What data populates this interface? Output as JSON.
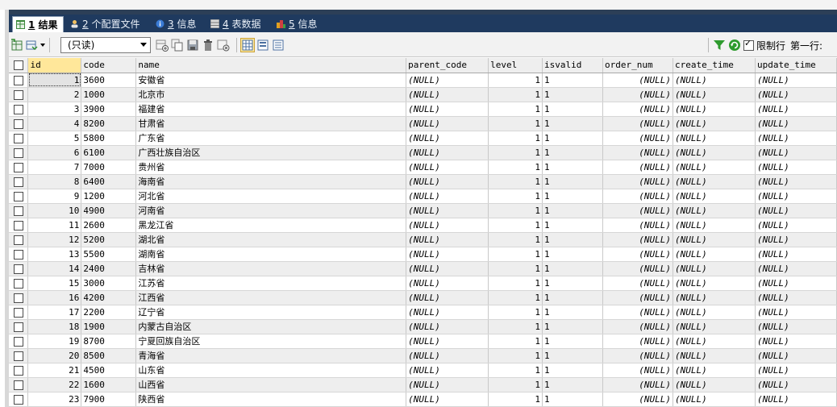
{
  "tabs": [
    {
      "num": "1",
      "label": "结果",
      "active": true,
      "icon": "grid-result-icon"
    },
    {
      "num": "2",
      "label": "个配置文件",
      "active": false,
      "icon": "profile-icon"
    },
    {
      "num": "3",
      "label": "信息",
      "active": false,
      "icon": "info-icon"
    },
    {
      "num": "4",
      "label": "表数据",
      "active": false,
      "icon": "table-data-icon"
    },
    {
      "num": "5",
      "label": "信息",
      "active": false,
      "icon": "info-history-icon"
    }
  ],
  "toolbar": {
    "mode_select": "(只读)",
    "limit_rows_label": "限制行",
    "first_row_label": "第一行:"
  },
  "columns": [
    "id",
    "code",
    "name",
    "parent_code",
    "level",
    "isvalid",
    "order_num",
    "create_time",
    "update_time"
  ],
  "rows": [
    [
      "1",
      "3600",
      "安徽省",
      "(NULL)",
      "1",
      "1",
      "(NULL)",
      "(NULL)",
      "(NULL)"
    ],
    [
      "2",
      "1000",
      "北京市",
      "(NULL)",
      "1",
      "1",
      "(NULL)",
      "(NULL)",
      "(NULL)"
    ],
    [
      "3",
      "3900",
      "福建省",
      "(NULL)",
      "1",
      "1",
      "(NULL)",
      "(NULL)",
      "(NULL)"
    ],
    [
      "4",
      "8200",
      "甘肃省",
      "(NULL)",
      "1",
      "1",
      "(NULL)",
      "(NULL)",
      "(NULL)"
    ],
    [
      "5",
      "5800",
      "广东省",
      "(NULL)",
      "1",
      "1",
      "(NULL)",
      "(NULL)",
      "(NULL)"
    ],
    [
      "6",
      "6100",
      "广西壮族自治区",
      "(NULL)",
      "1",
      "1",
      "(NULL)",
      "(NULL)",
      "(NULL)"
    ],
    [
      "7",
      "7000",
      "贵州省",
      "(NULL)",
      "1",
      "1",
      "(NULL)",
      "(NULL)",
      "(NULL)"
    ],
    [
      "8",
      "6400",
      "海南省",
      "(NULL)",
      "1",
      "1",
      "(NULL)",
      "(NULL)",
      "(NULL)"
    ],
    [
      "9",
      "1200",
      "河北省",
      "(NULL)",
      "1",
      "1",
      "(NULL)",
      "(NULL)",
      "(NULL)"
    ],
    [
      "10",
      "4900",
      "河南省",
      "(NULL)",
      "1",
      "1",
      "(NULL)",
      "(NULL)",
      "(NULL)"
    ],
    [
      "11",
      "2600",
      "黑龙江省",
      "(NULL)",
      "1",
      "1",
      "(NULL)",
      "(NULL)",
      "(NULL)"
    ],
    [
      "12",
      "5200",
      "湖北省",
      "(NULL)",
      "1",
      "1",
      "(NULL)",
      "(NULL)",
      "(NULL)"
    ],
    [
      "13",
      "5500",
      "湖南省",
      "(NULL)",
      "1",
      "1",
      "(NULL)",
      "(NULL)",
      "(NULL)"
    ],
    [
      "14",
      "2400",
      "吉林省",
      "(NULL)",
      "1",
      "1",
      "(NULL)",
      "(NULL)",
      "(NULL)"
    ],
    [
      "15",
      "3000",
      "江苏省",
      "(NULL)",
      "1",
      "1",
      "(NULL)",
      "(NULL)",
      "(NULL)"
    ],
    [
      "16",
      "4200",
      "江西省",
      "(NULL)",
      "1",
      "1",
      "(NULL)",
      "(NULL)",
      "(NULL)"
    ],
    [
      "17",
      "2200",
      "辽宁省",
      "(NULL)",
      "1",
      "1",
      "(NULL)",
      "(NULL)",
      "(NULL)"
    ],
    [
      "18",
      "1900",
      "内蒙古自治区",
      "(NULL)",
      "1",
      "1",
      "(NULL)",
      "(NULL)",
      "(NULL)"
    ],
    [
      "19",
      "8700",
      "宁夏回族自治区",
      "(NULL)",
      "1",
      "1",
      "(NULL)",
      "(NULL)",
      "(NULL)"
    ],
    [
      "20",
      "8500",
      "青海省",
      "(NULL)",
      "1",
      "1",
      "(NULL)",
      "(NULL)",
      "(NULL)"
    ],
    [
      "21",
      "4500",
      "山东省",
      "(NULL)",
      "1",
      "1",
      "(NULL)",
      "(NULL)",
      "(NULL)"
    ],
    [
      "22",
      "1600",
      "山西省",
      "(NULL)",
      "1",
      "1",
      "(NULL)",
      "(NULL)",
      "(NULL)"
    ],
    [
      "23",
      "7900",
      "陕西省",
      "(NULL)",
      "1",
      "1",
      "(NULL)",
      "(NULL)",
      "(NULL)"
    ]
  ],
  "colors": {
    "tab_bar": "#1f3a5f",
    "row_alt": "#eeeeee",
    "filter_green": "#2e9b2e"
  }
}
